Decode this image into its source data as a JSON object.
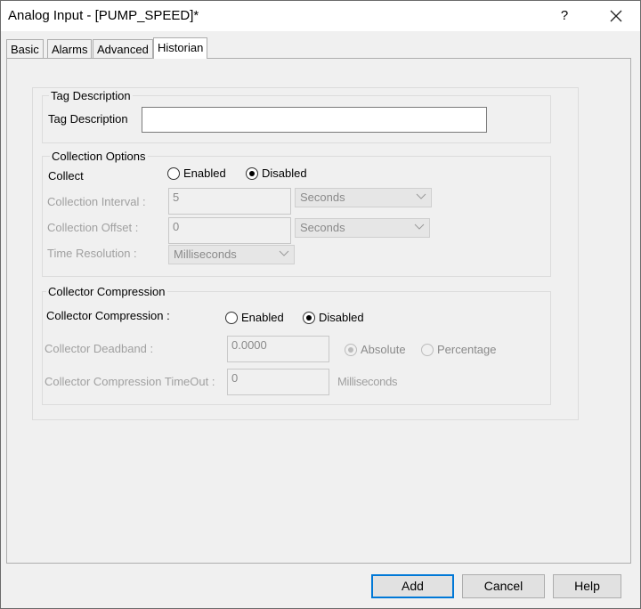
{
  "window": {
    "title": "Analog Input - [PUMP_SPEED]*",
    "help_label": "?",
    "close_icon": "close-icon"
  },
  "tabs": [
    {
      "label": "Basic"
    },
    {
      "label": "Alarms"
    },
    {
      "label": "Advanced"
    },
    {
      "label": "Historian",
      "active": true
    }
  ],
  "tag_description": {
    "group_label": "Tag Description",
    "field_label": "Tag Description",
    "value": ""
  },
  "collection": {
    "group_label": "Collection Options",
    "collect_label": "Collect",
    "enabled_label": "Enabled",
    "disabled_label": "Disabled",
    "selected": "Disabled",
    "interval_label": "Collection Interval :",
    "interval_value": "5",
    "interval_unit": "Seconds",
    "offset_label": "Collection Offset :",
    "offset_value": "0",
    "offset_unit": "Seconds",
    "resolution_label": "Time Resolution :",
    "resolution_value": "Milliseconds"
  },
  "compression": {
    "group_label": "Collector Compression",
    "field_label": "Collector Compression :",
    "enabled_label": "Enabled",
    "disabled_label": "Disabled",
    "selected": "Disabled",
    "deadband_label": "Collector Deadband :",
    "deadband_value": "0.0000",
    "absolute_label": "Absolute",
    "percentage_label": "Percentage",
    "deadband_mode": "Absolute",
    "timeout_label": "Collector Compression TimeOut :",
    "timeout_value": "0",
    "timeout_unit": "Milliseconds"
  },
  "buttons": {
    "add": "Add",
    "cancel": "Cancel",
    "help": "Help"
  },
  "colors": {
    "default_button_border": "#0078d7",
    "window_bg": "#f0f0f0"
  }
}
